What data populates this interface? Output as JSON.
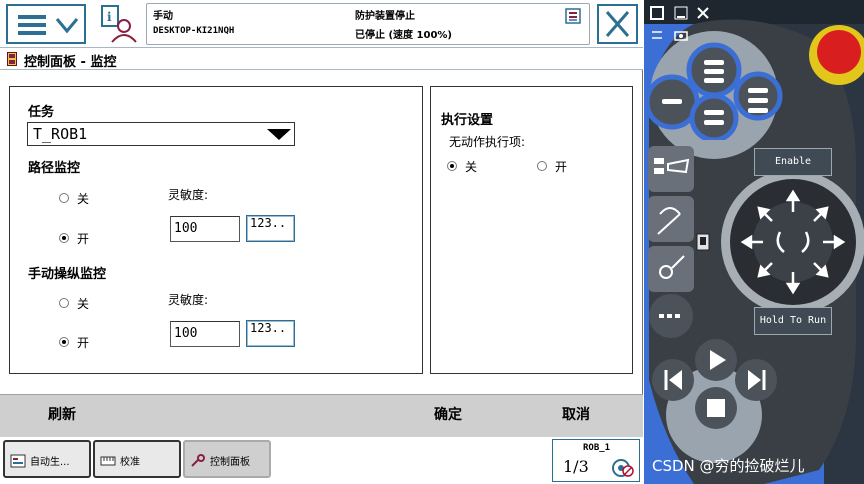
{
  "topbar": {
    "mode": "手动",
    "system_name": "DESKTOP-KI21NQH",
    "safety_state": "防护装置停止",
    "run_state": "已停止 (速度 100%)"
  },
  "title": "控制面板 - 监控",
  "left_panel": {
    "task_label": "任务",
    "task_value": "T_ROB1",
    "path_section": "路径监控",
    "path_off": "关",
    "path_on": "开",
    "path_sensitivity_label": "灵敏度:",
    "path_sensitivity_value": "100",
    "path_keypad": "123..",
    "jog_section": "手动操纵监控",
    "jog_off": "关",
    "jog_on": "开",
    "jog_sensitivity_label": "灵敏度:",
    "jog_sensitivity_value": "100",
    "jog_keypad": "123.."
  },
  "right_panel": {
    "title": "执行设置",
    "no_motion_label": "无动作执行项:",
    "off": "关",
    "on": "开"
  },
  "actions": {
    "refresh": "刷新",
    "ok": "确定",
    "cancel": "取消"
  },
  "taskbar": {
    "items": [
      {
        "label": "自动生..."
      },
      {
        "label": "校准"
      },
      {
        "label": "控制面板"
      }
    ],
    "robot": "ROB_1",
    "fraction": "1/3"
  },
  "pendant": {
    "enable": "Enable",
    "hold_to_run": "Hold To Run"
  },
  "watermark": "CSDN @穷的捡破烂儿",
  "colors": {
    "accent": "#2b6f92",
    "pendant_blue": "#3b6fd6",
    "emergency_red": "#d81e1e"
  }
}
